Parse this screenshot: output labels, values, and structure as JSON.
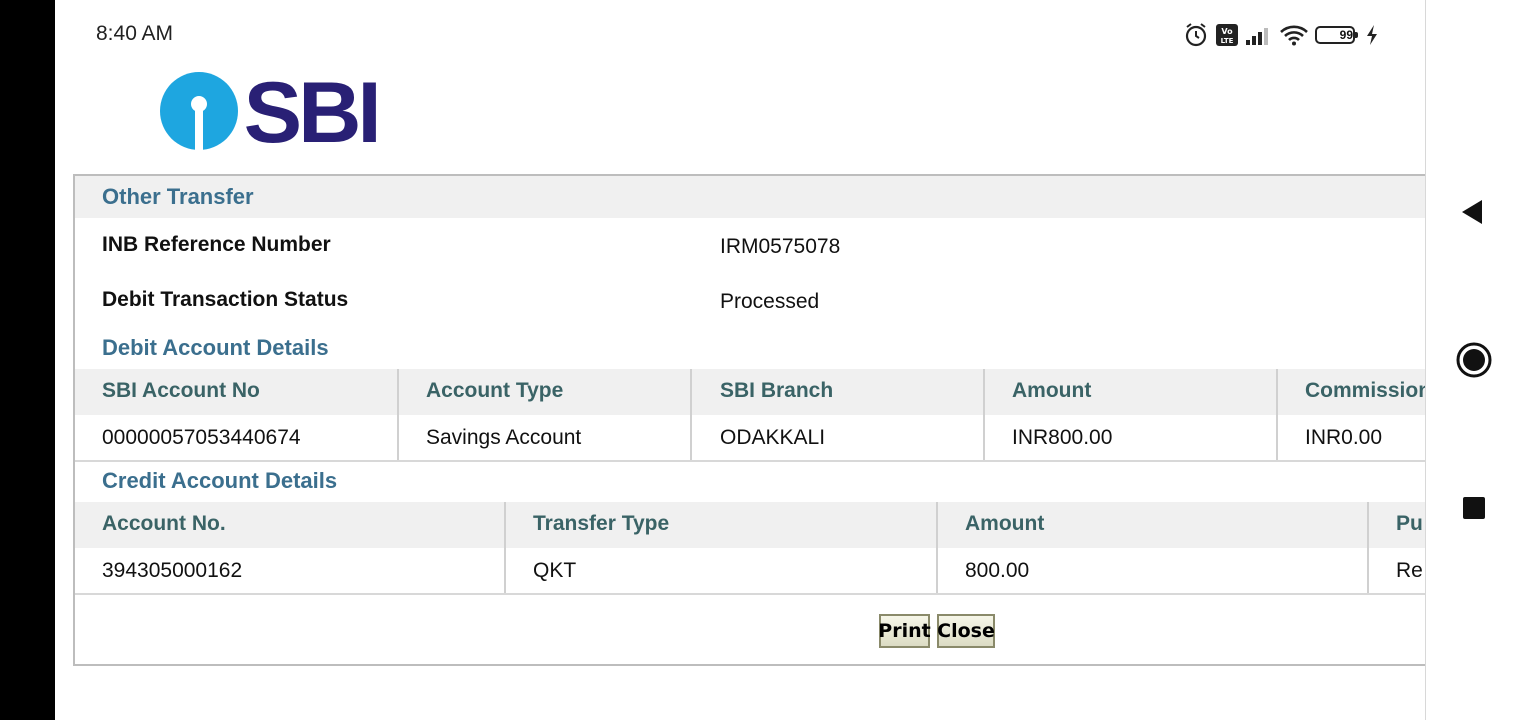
{
  "status_bar": {
    "time": "8:40 AM",
    "battery_level": "99",
    "icons": [
      "alarm-icon",
      "volte-icon",
      "signal-icon",
      "wifi-icon",
      "battery-icon",
      "charging-icon"
    ]
  },
  "logo": {
    "text": "SBI",
    "brand_color": "#292075",
    "emblem_color": "#1ea6e0"
  },
  "transfer": {
    "section_title": "Other Transfer",
    "fields": [
      {
        "label": "INB Reference Number",
        "value": "IRM0575078"
      },
      {
        "label": "Debit Transaction Status",
        "value": "Processed"
      }
    ]
  },
  "debit": {
    "section_title": "Debit Account Details",
    "headers": [
      "SBI Account No",
      "Account Type",
      "SBI Branch",
      "Amount",
      "Commission"
    ],
    "row": [
      "00000057053440674",
      "Savings Account",
      "ODAKKALI",
      "INR800.00",
      "INR0.00"
    ]
  },
  "credit": {
    "section_title": "Credit Account Details",
    "headers": [
      "Account No.",
      "Transfer Type",
      "Amount",
      "Pu"
    ],
    "row": [
      "394305000162",
      "QKT",
      "800.00",
      "Re"
    ]
  },
  "buttons": {
    "print": "Print",
    "close": "Close"
  },
  "nav": {
    "icons": [
      "back-icon",
      "home-icon",
      "recents-icon"
    ]
  }
}
